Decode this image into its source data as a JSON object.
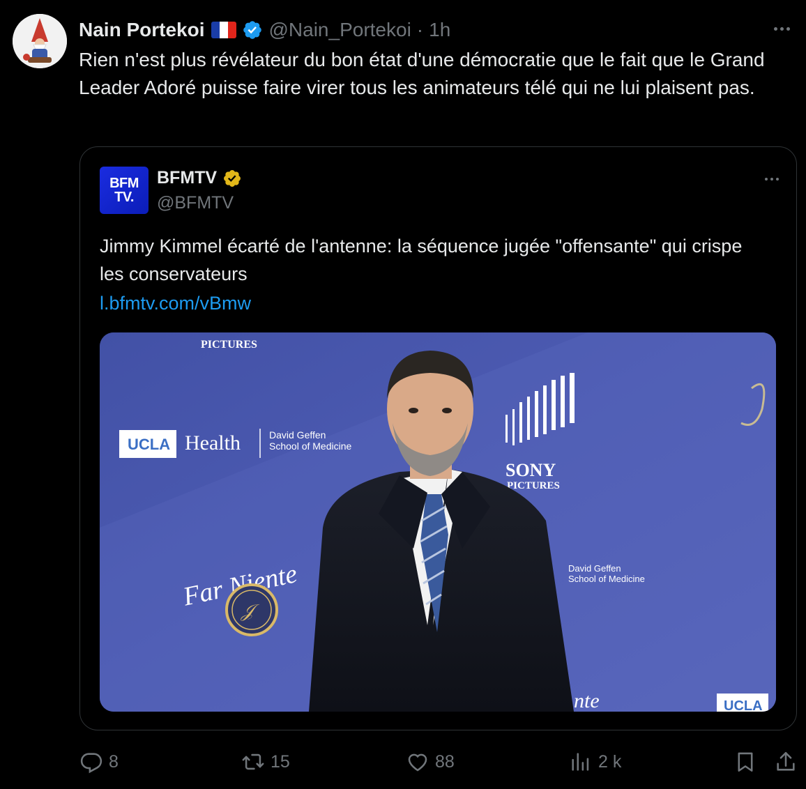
{
  "author": {
    "name": "Nain Portekoi",
    "flag": "🇫🇷",
    "handle": "@Nain_Portekoi",
    "separator": "·",
    "time": "1h"
  },
  "tweet": {
    "text": "Rien n'est plus révélateur du bon état d'une démocratie que le fait que le Grand Leader Adoré puisse faire virer tous les animateurs télé qui ne lui plaisent pas."
  },
  "quote": {
    "logo_line1": "BFM",
    "logo_line2": "TV.",
    "name": "BFMTV",
    "handle": "@BFMTV",
    "text": "Jimmy Kimmel écarté de l'antenne: la séquence jugée \"offensante\" qui crispe les conservateurs",
    "link": "l.bfmtv.com/vBmw",
    "media": {
      "backdrop_text": {
        "sony_top": "PICTURES",
        "ucla": "UCLA",
        "health": "Health",
        "geffen_line1": "David Geffen",
        "geffen_line2": "School of Medicine",
        "sony": "SONY",
        "pictures": "PICTURES",
        "far_niente": "Far Niente",
        "geffen2_line1": "David Geffen",
        "geffen2_line2": "School of Medicine",
        "ucla_bottom": "UCLA",
        "niente_bottom": "nte"
      }
    }
  },
  "actions": {
    "replies": "8",
    "reposts": "15",
    "likes": "88",
    "views": "2 k"
  },
  "colors": {
    "background": "#000000",
    "text": "#e7e9ea",
    "muted": "#71767b",
    "link": "#1d9bf0",
    "border": "#2f3336",
    "verified_blue": "#1d9bf0",
    "verified_gold": "#e2b719"
  },
  "icons": {
    "verified": "verified-badge-icon",
    "reply": "reply-icon",
    "repost": "repost-icon",
    "like": "heart-icon",
    "views": "analytics-icon",
    "bookmark": "bookmark-icon",
    "share": "share-icon"
  }
}
